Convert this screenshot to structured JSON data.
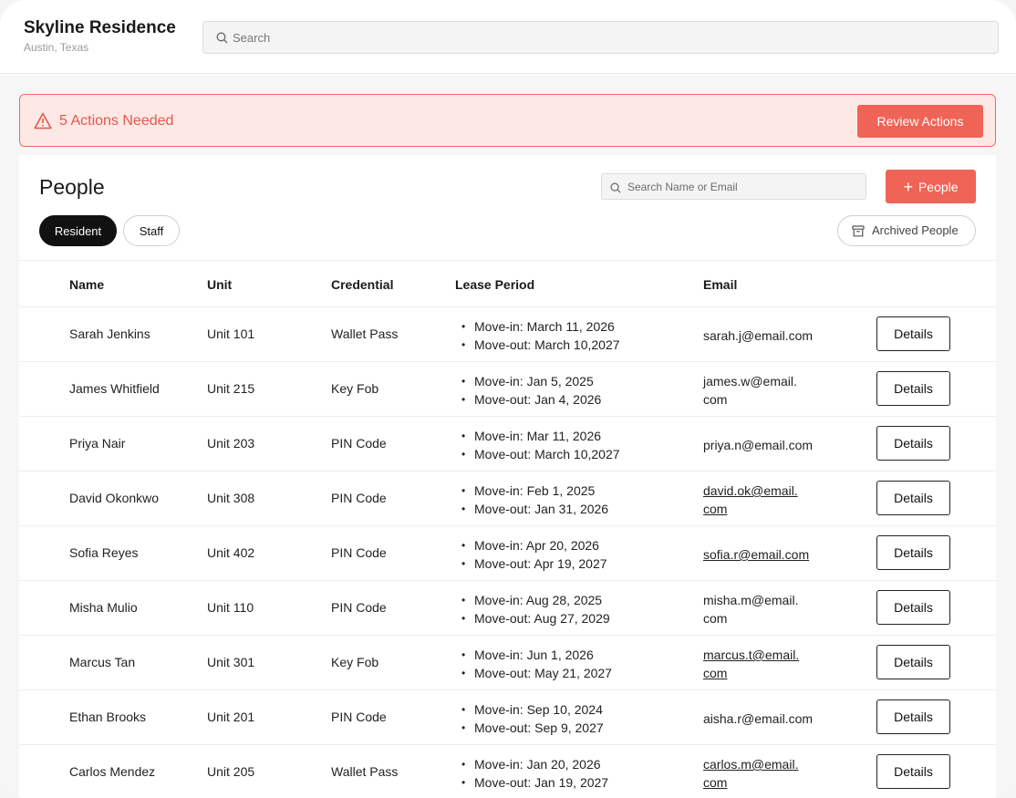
{
  "header": {
    "property_name": "Skyline Residence",
    "property_location": "Austin, Texas",
    "search_placeholder": "Search"
  },
  "alert": {
    "text": "5 Actions Needed",
    "button_label": "Review Actions"
  },
  "people": {
    "title": "People",
    "search_placeholder": "Search Name or Email",
    "add_button_label": "People",
    "tabs": [
      {
        "label": "Resident",
        "active": true
      },
      {
        "label": "Staff",
        "active": false
      }
    ],
    "archived_label": "Archived People"
  },
  "table": {
    "columns": [
      "Name",
      "Unit",
      "Credential",
      "Lease Period",
      "Email"
    ],
    "details_label": "Details",
    "rows": [
      {
        "name": "Sarah Jenkins",
        "unit": "Unit 101",
        "credential": "Wallet Pass",
        "move_in": "Move-in: March 11, 2026",
        "move_out": "Move-out: March 10,2027",
        "email_line1": "sarah.j@email.com",
        "email_line2": ""
      },
      {
        "name": "James Whitfield",
        "unit": "Unit 215",
        "credential": "Key Fob",
        "move_in": "Move-in: Jan 5, 2025",
        "move_out": "Move-out: Jan 4, 2026",
        "email_line1": "james.w@email.",
        "email_line2": "com"
      },
      {
        "name": "Priya Nair",
        "unit": "Unit 203",
        "credential": "PIN Code",
        "move_in": "Move-in: Mar 11, 2026",
        "move_out": "Move-out: March 10,2027",
        "email_line1": "priya.n@email.com",
        "email_line2": ""
      },
      {
        "name": "David Okonkwo",
        "unit": "Unit 308",
        "credential": "PIN Code",
        "move_in": "Move-in: Feb 1, 2025",
        "move_out": "Move-out: Jan 31, 2026",
        "email_line1": "david.ok@email.",
        "email_line2": "com"
      },
      {
        "name": "Sofia Reyes",
        "unit": "Unit 402",
        "credential": "PIN Code",
        "move_in": "Move-in: Apr 20, 2026",
        "move_out": "Move-out: Apr 19, 2027",
        "email_line1": "sofia.r@email.com",
        "email_line2": ""
      },
      {
        "name": "Misha Mulio",
        "unit": "Unit 110",
        "credential": "PIN Code",
        "move_in": "Move-in: Aug 28, 2025",
        "move_out": "Move-out: Aug 27, 2029",
        "email_line1": "misha.m@email.",
        "email_line2": "com"
      },
      {
        "name": "Marcus Tan",
        "unit": "Unit 301",
        "credential": "Key Fob",
        "move_in": "Move-in: Jun 1, 2026",
        "move_out": "Move-out: May 21, 2027",
        "email_line1": "marcus.t@email.",
        "email_line2": "com"
      },
      {
        "name": "Ethan Brooks",
        "unit": "Unit 201",
        "credential": "PIN Code",
        "move_in": "Move-in: Sep 10, 2024",
        "move_out": "Move-out: Sep 9, 2027",
        "email_line1": "aisha.r@email.com",
        "email_line2": ""
      },
      {
        "name": "Carlos Mendez",
        "unit": "Unit 205",
        "credential": "Wallet Pass",
        "move_in": "Move-in: Jan 20, 2026",
        "move_out": "Move-out: Jan 19, 2027",
        "email_line1": "carlos.m@email.",
        "email_line2": "com"
      }
    ]
  },
  "colors": {
    "accent": "#ef6456",
    "alert_bg": "#fde8e6",
    "alert_text": "#e2584b"
  },
  "icons": {
    "search": "search-icon",
    "warning": "warning-icon",
    "plus": "plus-icon",
    "archive": "archive-icon"
  }
}
